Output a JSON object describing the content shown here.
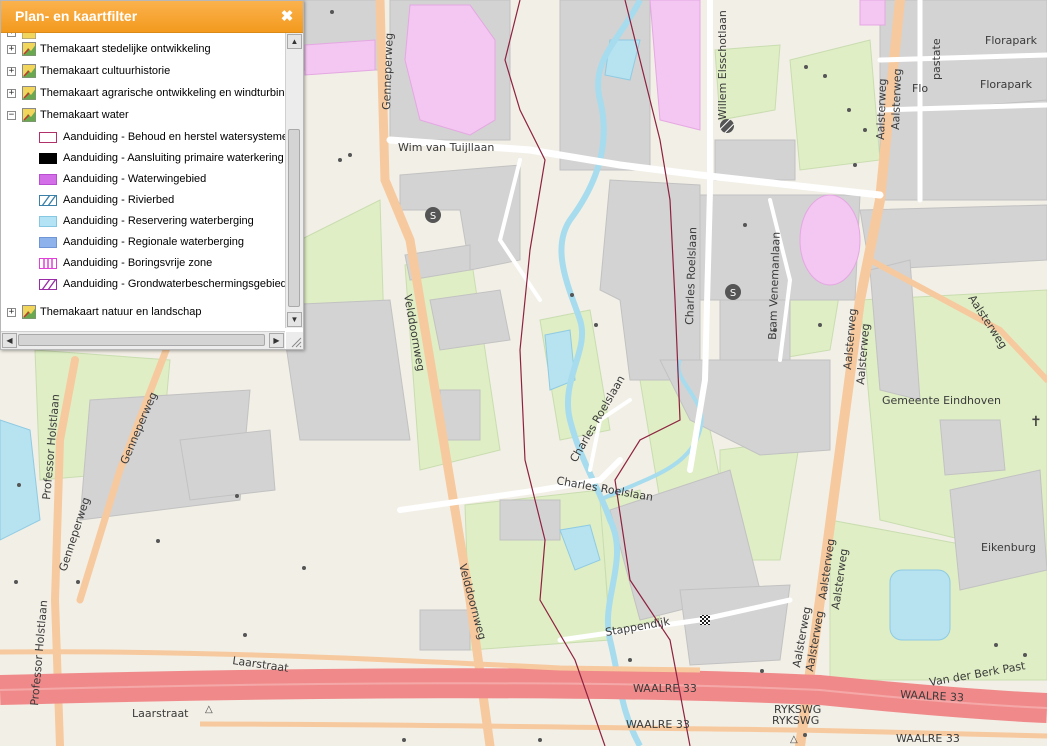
{
  "panel": {
    "title": "Plan- en kaartfilter",
    "close_label": "✖",
    "layers": [
      {
        "label": "Themakaart stedelijke ontwikkeling",
        "expanded": false
      },
      {
        "label": "Themakaart cultuurhistorie",
        "expanded": false
      },
      {
        "label": "Themakaart agrarische ontwikkeling en windturbines",
        "expanded": false
      },
      {
        "label": "Themakaart water",
        "expanded": true
      },
      {
        "label": "Themakaart natuur en landschap",
        "expanded": false
      }
    ],
    "legend_items": [
      {
        "label": "Aanduiding - Behoud en herstel watersystemen",
        "style": "outline",
        "color": "#b0306a"
      },
      {
        "label": "Aanduiding - Aansluiting primaire waterkering",
        "style": "fill",
        "color": "#000000"
      },
      {
        "label": "Aanduiding - Waterwingebied",
        "style": "fill",
        "color": "#d36ee8"
      },
      {
        "label": "Aanduiding - Rivierbed",
        "style": "hatch",
        "color": "#3a80a8"
      },
      {
        "label": "Aanduiding - Reservering waterberging",
        "style": "fill",
        "color": "#b3e3f5"
      },
      {
        "label": "Aanduiding - Regionale waterberging",
        "style": "fill",
        "color": "#8eb2ec"
      },
      {
        "label": "Aanduiding - Boringsvrije zone",
        "style": "vstripes",
        "color": "#e040d8"
      },
      {
        "label": "Aanduiding - Grondwaterbeschermingsgebied",
        "style": "hatch",
        "color": "#9b2aa6"
      }
    ]
  },
  "map": {
    "labels": {
      "florapark1": "Florapark",
      "florapark2": "Florapark",
      "flo": "Flo",
      "pastate": "pastate",
      "willem": "Willem Elsschotlaan",
      "gennep_top": "Genneperweg",
      "wim": "Wim van Tuijllaan",
      "aalsterweg_n": "Aalsterweg",
      "aalsterweg_ne": "Aalsterweg",
      "aalsterweg_diag": "Aalsterweg",
      "charles1": "Charles Roelslaan",
      "bram": "Bram Venemanlaan",
      "veld1": "Velddoornweg",
      "gemeente": "Gemeente Eindhoven",
      "aalster_m1": "Aalsterweg",
      "aalster_m2": "Aalsterweg",
      "charles2": "Charles Roelslaan",
      "charles3": "Charles Roelslaan",
      "holst1": "Professor Holstlaan",
      "gennep1": "Genneperweg",
      "gennep2": "Genneperweg",
      "eikenburg": "Eikenburg",
      "aalster_s1": "Aalsterweg",
      "aalster_s2": "Aalsterweg",
      "veld2": "Velddoornweg",
      "holst2": "Professor Holstlaan",
      "stappen": "Stappendijk",
      "aalster_s3": "Aalsterweg",
      "aalster_s4": "Aalsterweg",
      "laar1": "Laarstraat",
      "berk": "Van der Berk Past",
      "waalre1": "WAALRE 33",
      "waalre2": "WAALRE 33",
      "laar2": "Laarstraat",
      "ryk1": "RYKSWG",
      "ryk2": "RYKSWG",
      "waalre3": "WAALRE 33",
      "waalre4": "WAALRE 33"
    }
  },
  "colors": {
    "header": "#f5a02a",
    "map_bg": "#f2efe6",
    "park": "#dfeec4",
    "building": "#d3d3d3",
    "water": "#b7e2f0",
    "highway": "#f08a8a",
    "main_road": "#f7c99e",
    "boundary": "#8e2240",
    "pink_area": "#f4c6f2"
  }
}
